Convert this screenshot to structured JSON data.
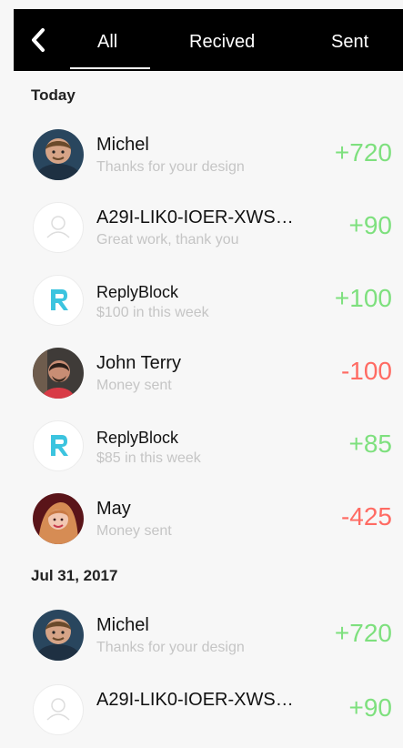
{
  "tabs": {
    "all": "All",
    "received": "Recived",
    "sent": "Sent"
  },
  "sections": {
    "today": "Today",
    "jul31": "Jul 31, 2017"
  },
  "colors": {
    "positive": "#7ee07e",
    "negative": "#ff6b63",
    "reply_logo": "#3cc4df"
  },
  "transactions": [
    {
      "name": "Michel",
      "subtitle": "Thanks for your design",
      "amount": "+720",
      "avatar": "michel-photo"
    },
    {
      "name": "A29I-LIK0-IOER-XWS…",
      "subtitle": "Great work, thank you",
      "amount": "+90",
      "avatar": "user-placeholder-icon"
    },
    {
      "name": "ReplyBlock",
      "subtitle": "$100 in this week",
      "amount": "+100",
      "avatar": "replyblock-logo"
    },
    {
      "name": "John Terry",
      "subtitle": "Money sent",
      "amount": "-100",
      "avatar": "john-terry-photo"
    },
    {
      "name": "ReplyBlock",
      "subtitle": "$85 in this week",
      "amount": "+85",
      "avatar": "replyblock-logo"
    },
    {
      "name": "May",
      "subtitle": "Money sent",
      "amount": "-425",
      "avatar": "may-photo"
    },
    {
      "name": "Michel",
      "subtitle": "Thanks for your design",
      "amount": "+720",
      "avatar": "michel-photo"
    },
    {
      "name": "A29I-LIK0-IOER-XWS…",
      "subtitle": "",
      "amount": "+90",
      "avatar": "user-placeholder-icon"
    }
  ]
}
